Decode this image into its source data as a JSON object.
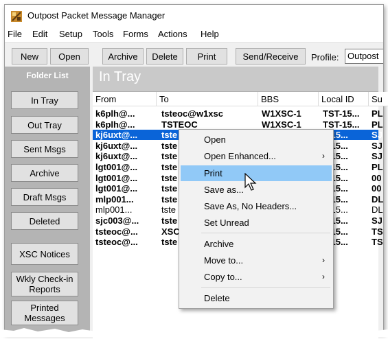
{
  "window": {
    "title": "Outpost Packet Message Manager"
  },
  "menu": [
    "File",
    "Edit",
    "Setup",
    "Tools",
    "Forms",
    "Actions",
    "Help"
  ],
  "toolbar": {
    "buttons": [
      "New",
      "Open",
      "Archive",
      "Delete",
      "Print",
      "Send/Receive"
    ],
    "profile_label": "Profile:",
    "profile_value": "Outpost"
  },
  "sidebar": {
    "title": "Folder List",
    "folders": [
      "In Tray",
      "Out Tray",
      "Sent Msgs",
      "Archive",
      "Draft Msgs",
      "Deleted",
      "XSC Notices",
      "Wkly Check-in Reports",
      "Printed Messages"
    ]
  },
  "main": {
    "title": "In Tray",
    "columns": [
      "From",
      "To",
      "BBS",
      "Local ID",
      "Su"
    ],
    "rows": [
      {
        "from": "k6plh@...",
        "to": "tsteoc@w1xsc",
        "bbs": "W1XSC-1",
        "local_id": "TST-15...",
        "subject": "PL",
        "bold": true
      },
      {
        "from": "k6plh@...",
        "to": "TSTEOC",
        "bbs": "W1XSC-1",
        "local_id": "TST-15...",
        "subject": "PL",
        "bold": true
      },
      {
        "from": "kj6uxt@...",
        "to": "tste",
        "bbs": "",
        "local_id": "T-15...",
        "subject": "SJ",
        "bold": true,
        "selected": true
      },
      {
        "from": "kj6uxt@...",
        "to": "tste",
        "bbs": "",
        "local_id": "T-15...",
        "subject": "SJ",
        "bold": true
      },
      {
        "from": "kj6uxt@...",
        "to": "tste",
        "bbs": "",
        "local_id": "T-15...",
        "subject": "SJ",
        "bold": true
      },
      {
        "from": "lgt001@...",
        "to": "tste",
        "bbs": "",
        "local_id": "T-15...",
        "subject": "PL",
        "bold": true
      },
      {
        "from": "lgt001@...",
        "to": "tste",
        "bbs": "",
        "local_id": "T-15...",
        "subject": "00",
        "bold": true
      },
      {
        "from": "lgt001@...",
        "to": "tste",
        "bbs": "",
        "local_id": "T-15...",
        "subject": "00",
        "bold": true
      },
      {
        "from": "mlp001...",
        "to": "tste",
        "bbs": "",
        "local_id": "T-15...",
        "subject": "DL",
        "bold": true
      },
      {
        "from": "mlp001...",
        "to": "tste",
        "bbs": "",
        "local_id": "T-15...",
        "subject": "DL",
        "bold": false
      },
      {
        "from": "sjc003@...",
        "to": "tste",
        "bbs": "",
        "local_id": "T-15...",
        "subject": "SJ",
        "bold": true
      },
      {
        "from": "tsteoc@...",
        "to": "XSC",
        "bbs": "",
        "local_id": "T-15...",
        "subject": "TS",
        "bold": true
      },
      {
        "from": "tsteoc@...",
        "to": "tste",
        "bbs": "",
        "local_id": "T-15...",
        "subject": "TS",
        "bold": true
      }
    ]
  },
  "context_menu": {
    "items": [
      {
        "label": "Open"
      },
      {
        "label": "Open Enhanced...",
        "submenu": true
      },
      {
        "label": "Print",
        "hover": true
      },
      {
        "label": "Save as..."
      },
      {
        "label": "Save As, No Headers..."
      },
      {
        "label": "Set Unread"
      },
      {
        "label": "Archive"
      },
      {
        "label": "Move to...",
        "submenu": true
      },
      {
        "label": "Copy to...",
        "submenu": true
      },
      {
        "label": "Delete"
      }
    ]
  },
  "colors": {
    "selection": "#0a64d8",
    "menu_hover": "#91c9f7",
    "panel": "#c9c9c9"
  },
  "icons": [
    "app-icon",
    "mouse-pointer-icon",
    "chevron-right-icon"
  ]
}
